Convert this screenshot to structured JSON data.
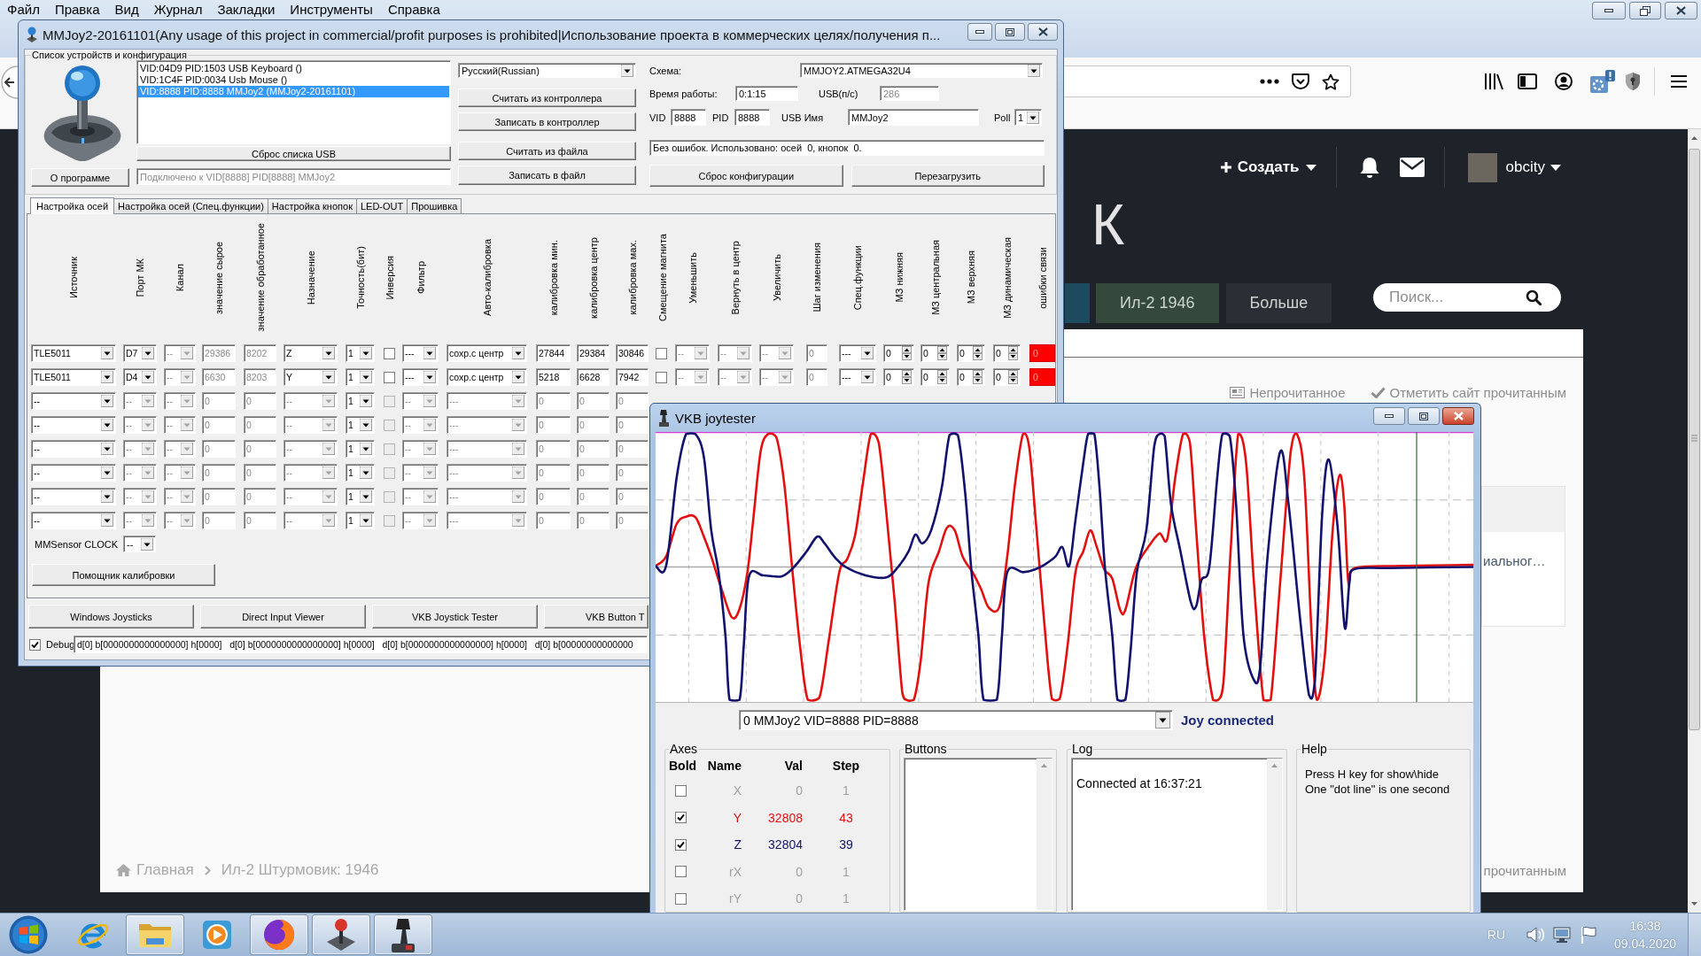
{
  "browser": {
    "menu": [
      "Файл",
      "Правка",
      "Вид",
      "Журнал",
      "Закладки",
      "Инструменты",
      "Справка"
    ],
    "site": {
      "create": "Создать",
      "user": "obcity",
      "logo": "К",
      "nav": [
        {
          "color": "#1d4a5e"
        },
        {
          "label": "Ил-2 1946",
          "color": "#34493b"
        },
        {
          "label": "Больше",
          "color": "#2a2e35"
        }
      ],
      "search": {
        "placeholder": "Поиск..."
      },
      "unread": "Непрочитанное",
      "mark_read": "Отметить сайт прочитанным",
      "card_text": "иальног…",
      "footer_link": "прочитанным",
      "breadcrumb": [
        "Главная",
        "Ил-2 Штурмовик: 1946"
      ]
    }
  },
  "mmjoy": {
    "title": "MMJoy2-20161101(Any usage of this project in commercial/profit purposes is prohibited|Использование проекта в коммерческих целях/получения п...",
    "group": "Список устройств и конфигурация",
    "devices": [
      {
        "label": "VID:04D9 PID:1503 USB Keyboard ()",
        "selected": false
      },
      {
        "label": "VID:1C4F PID:0034 Usb Mouse ()",
        "selected": false
      },
      {
        "label": "VID:8888 PID:8888 MMJoy2 (MMJoy2-20161101)",
        "selected": true
      }
    ],
    "reset_usb": "Сброс списка USB",
    "about": "О программе",
    "connection": {
      "value": "Подключено к VID[8888] PID[8888] MMJoy2",
      "disabled": true
    },
    "language": "Русский(Russian)",
    "actions": [
      "Считать из контроллера",
      "Записать в контроллер",
      "Считать из файла",
      "Записать в файл"
    ],
    "schema": {
      "label": "Схема:",
      "value": "MMJOY2.ATMEGA32U4"
    },
    "uptime": {
      "label": "Время работы:",
      "value": "0:1:15"
    },
    "usb_rate": {
      "label": "USB(п/с)",
      "value": "286",
      "disabled": true
    },
    "vid": {
      "label": "VID",
      "value": "8888"
    },
    "pid": {
      "label": "PID",
      "value": "8888"
    },
    "usb_name": {
      "label": "USB Имя",
      "value": "MMJoy2"
    },
    "poll": {
      "label": "Poll",
      "value": "1"
    },
    "status": "Без ошибок. Использовано: осей  0, кнопок  0.",
    "reset_config": "Сброс конфигурации",
    "reboot": "Перезагрузить",
    "tabs": [
      {
        "label": "Настройка осей",
        "selected": true
      },
      {
        "label": "Настройка осей (Спец.функции)",
        "selected": false
      },
      {
        "label": "Настройка кнопок",
        "selected": false
      },
      {
        "label": "LED-OUT",
        "selected": false
      },
      {
        "label": "Прошивка",
        "selected": false
      }
    ],
    "columns": [
      "Источник",
      "Порт МК",
      "Канал",
      "значение сырое",
      "значение обработанное",
      "Назначение",
      "Точность(бит)",
      "Инверсия",
      "Фильтр",
      "Авто-калибровка",
      "калибровка мин.",
      "калибровка центр",
      "калибровка мах.",
      "Смещение магнита",
      "Уменьшить",
      "Вернуть в центр",
      "Увеличить",
      "Шаг изменения",
      "Спец.функции",
      "МЗ нижняя",
      "МЗ центральная",
      "МЗ верхняя",
      "МЗ динамическая",
      "ошибки связи"
    ],
    "rows": [
      {
        "cells": [
          {
            "kind": "combo",
            "value": "TLE5011",
            "disabled": false
          },
          {
            "kind": "combo",
            "value": "D7",
            "disabled": false
          },
          {
            "kind": "combo",
            "value": "--",
            "disabled": true
          },
          {
            "kind": "field",
            "value": "29386",
            "disabled": true
          },
          {
            "kind": "field",
            "value": "8202",
            "disabled": true
          },
          {
            "kind": "combo",
            "value": "Z",
            "disabled": false
          },
          {
            "kind": "combo",
            "value": "1",
            "disabled": false
          },
          {
            "kind": "check",
            "checked": false,
            "disabled": false
          },
          {
            "kind": "combo",
            "value": "---",
            "disabled": false
          },
          {
            "kind": "combo",
            "value": "сохр.с центр",
            "disabled": false
          },
          {
            "kind": "field",
            "value": "27844",
            "disabled": false
          },
          {
            "kind": "field",
            "value": "29384",
            "disabled": false
          },
          {
            "kind": "field",
            "value": "30846",
            "disabled": false
          },
          {
            "kind": "check",
            "checked": false,
            "disabled": false
          },
          {
            "kind": "combo",
            "value": "--",
            "disabled": true
          },
          {
            "kind": "combo",
            "value": "--",
            "disabled": true
          },
          {
            "kind": "combo",
            "value": "--",
            "disabled": true
          },
          {
            "kind": "field",
            "value": "0",
            "disabled": true
          },
          {
            "kind": "combo",
            "value": "---",
            "disabled": false
          },
          {
            "kind": "spin",
            "value": "0",
            "disabled": false
          },
          {
            "kind": "spin",
            "value": "0",
            "disabled": false
          },
          {
            "kind": "spin",
            "value": "0",
            "disabled": false
          },
          {
            "kind": "spin",
            "value": "0",
            "disabled": false
          },
          {
            "kind": "error",
            "value": "0",
            "on": true,
            "disabled": false
          }
        ]
      },
      {
        "cells": [
          {
            "kind": "combo",
            "value": "TLE5011",
            "disabled": false
          },
          {
            "kind": "combo",
            "value": "D4",
            "disabled": false
          },
          {
            "kind": "combo",
            "value": "--",
            "disabled": true
          },
          {
            "kind": "field",
            "value": "6630",
            "disabled": true
          },
          {
            "kind": "field",
            "value": "8203",
            "disabled": true
          },
          {
            "kind": "combo",
            "value": "Y",
            "disabled": false
          },
          {
            "kind": "combo",
            "value": "1",
            "disabled": false
          },
          {
            "kind": "check",
            "checked": false,
            "disabled": false
          },
          {
            "kind": "combo",
            "value": "---",
            "disabled": false
          },
          {
            "kind": "combo",
            "value": "сохр.с центр",
            "disabled": false
          },
          {
            "kind": "field",
            "value": "5218",
            "disabled": false
          },
          {
            "kind": "field",
            "value": "6628",
            "disabled": false
          },
          {
            "kind": "field",
            "value": "7942",
            "disabled": false
          },
          {
            "kind": "check",
            "checked": false,
            "disabled": false
          },
          {
            "kind": "combo",
            "value": "--",
            "disabled": true
          },
          {
            "kind": "combo",
            "value": "--",
            "disabled": true
          },
          {
            "kind": "combo",
            "value": "--",
            "disabled": true
          },
          {
            "kind": "field",
            "value": "0",
            "disabled": true
          },
          {
            "kind": "combo",
            "value": "---",
            "disabled": false
          },
          {
            "kind": "spin",
            "value": "0",
            "disabled": false
          },
          {
            "kind": "spin",
            "value": "0",
            "disabled": false
          },
          {
            "kind": "spin",
            "value": "0",
            "disabled": false
          },
          {
            "kind": "spin",
            "value": "0",
            "disabled": false
          },
          {
            "kind": "error",
            "value": "0",
            "on": true,
            "disabled": false
          }
        ]
      },
      {
        "cells": [
          {
            "kind": "combo",
            "value": "--",
            "disabled": false
          },
          {
            "kind": "combo",
            "value": "--",
            "disabled": true
          },
          {
            "kind": "combo",
            "value": "--",
            "disabled": true
          },
          {
            "kind": "field",
            "value": "0",
            "disabled": true
          },
          {
            "kind": "field",
            "value": "0",
            "disabled": true
          },
          {
            "kind": "combo",
            "value": "--",
            "disabled": true
          },
          {
            "kind": "combo",
            "value": "1",
            "disabled": false
          },
          {
            "kind": "check",
            "checked": false,
            "disabled": true
          },
          {
            "kind": "combo",
            "value": "--",
            "disabled": true
          },
          {
            "kind": "combo",
            "value": "---",
            "disabled": true
          },
          {
            "kind": "field",
            "value": "0",
            "disabled": true
          },
          {
            "kind": "field",
            "value": "0",
            "disabled": true
          },
          {
            "kind": "field",
            "value": "0",
            "disabled": true
          }
        ]
      },
      {
        "cells": [
          {
            "kind": "combo",
            "value": "--",
            "disabled": false
          },
          {
            "kind": "combo",
            "value": "--",
            "disabled": true
          },
          {
            "kind": "combo",
            "value": "--",
            "disabled": true
          },
          {
            "kind": "field",
            "value": "0",
            "disabled": true
          },
          {
            "kind": "field",
            "value": "0",
            "disabled": true
          },
          {
            "kind": "combo",
            "value": "--",
            "disabled": true
          },
          {
            "kind": "combo",
            "value": "1",
            "disabled": false
          },
          {
            "kind": "check",
            "checked": false,
            "disabled": true
          },
          {
            "kind": "combo",
            "value": "--",
            "disabled": true
          },
          {
            "kind": "combo",
            "value": "---",
            "disabled": true
          },
          {
            "kind": "field",
            "value": "0",
            "disabled": true
          },
          {
            "kind": "field",
            "value": "0",
            "disabled": true
          },
          {
            "kind": "field",
            "value": "0",
            "disabled": true
          }
        ]
      },
      {
        "cells": [
          {
            "kind": "combo",
            "value": "--",
            "disabled": false
          },
          {
            "kind": "combo",
            "value": "--",
            "disabled": true
          },
          {
            "kind": "combo",
            "value": "--",
            "disabled": true
          },
          {
            "kind": "field",
            "value": "0",
            "disabled": true
          },
          {
            "kind": "field",
            "value": "0",
            "disabled": true
          },
          {
            "kind": "combo",
            "value": "--",
            "disabled": true
          },
          {
            "kind": "combo",
            "value": "1",
            "disabled": false
          },
          {
            "kind": "check",
            "checked": false,
            "disabled": true
          },
          {
            "kind": "combo",
            "value": "--",
            "disabled": true
          },
          {
            "kind": "combo",
            "value": "---",
            "disabled": true
          },
          {
            "kind": "field",
            "value": "0",
            "disabled": true
          },
          {
            "kind": "field",
            "value": "0",
            "disabled": true
          },
          {
            "kind": "field",
            "value": "0",
            "disabled": true
          }
        ]
      },
      {
        "cells": [
          {
            "kind": "combo",
            "value": "--",
            "disabled": false
          },
          {
            "kind": "combo",
            "value": "--",
            "disabled": true
          },
          {
            "kind": "combo",
            "value": "--",
            "disabled": true
          },
          {
            "kind": "field",
            "value": "0",
            "disabled": true
          },
          {
            "kind": "field",
            "value": "0",
            "disabled": true
          },
          {
            "kind": "combo",
            "value": "--",
            "disabled": true
          },
          {
            "kind": "combo",
            "value": "1",
            "disabled": false
          },
          {
            "kind": "check",
            "checked": false,
            "disabled": true
          },
          {
            "kind": "combo",
            "value": "--",
            "disabled": true
          },
          {
            "kind": "combo",
            "value": "---",
            "disabled": true
          },
          {
            "kind": "field",
            "value": "0",
            "disabled": true
          },
          {
            "kind": "field",
            "value": "0",
            "disabled": true
          },
          {
            "kind": "field",
            "value": "0",
            "disabled": true
          }
        ]
      },
      {
        "cells": [
          {
            "kind": "combo",
            "value": "--",
            "disabled": false
          },
          {
            "kind": "combo",
            "value": "--",
            "disabled": true
          },
          {
            "kind": "combo",
            "value": "--",
            "disabled": true
          },
          {
            "kind": "field",
            "value": "0",
            "disabled": true
          },
          {
            "kind": "field",
            "value": "0",
            "disabled": true
          },
          {
            "kind": "combo",
            "value": "--",
            "disabled": true
          },
          {
            "kind": "combo",
            "value": "1",
            "disabled": false
          },
          {
            "kind": "check",
            "checked": false,
            "disabled": true
          },
          {
            "kind": "combo",
            "value": "--",
            "disabled": true
          },
          {
            "kind": "combo",
            "value": "---",
            "disabled": true
          },
          {
            "kind": "field",
            "value": "0",
            "disabled": true
          },
          {
            "kind": "field",
            "value": "0",
            "disabled": true
          },
          {
            "kind": "field",
            "value": "0",
            "disabled": true
          }
        ]
      },
      {
        "cells": [
          {
            "kind": "combo",
            "value": "--",
            "disabled": false
          },
          {
            "kind": "combo",
            "value": "--",
            "disabled": true
          },
          {
            "kind": "combo",
            "value": "--",
            "disabled": true
          },
          {
            "kind": "field",
            "value": "0",
            "disabled": true
          },
          {
            "kind": "field",
            "value": "0",
            "disabled": true
          },
          {
            "kind": "combo",
            "value": "--",
            "disabled": true
          },
          {
            "kind": "combo",
            "value": "1",
            "disabled": false
          },
          {
            "kind": "check",
            "checked": false,
            "disabled": true
          },
          {
            "kind": "combo",
            "value": "--",
            "disabled": true
          },
          {
            "kind": "combo",
            "value": "---",
            "disabled": true
          },
          {
            "kind": "field",
            "value": "0",
            "disabled": true
          },
          {
            "kind": "field",
            "value": "0",
            "disabled": true
          },
          {
            "kind": "field",
            "value": "0",
            "disabled": true
          }
        ]
      }
    ],
    "clock": {
      "label": "MMSensor CLOCK",
      "value": "--"
    },
    "calibration": "Помощник калибровки",
    "tools": [
      "Windows Joysticks",
      "Direct Input Viewer",
      "VKB Joystick Tester",
      "VKB Button T"
    ],
    "debug": {
      "label": "Debug",
      "checked": true,
      "value": "d[0] b[0000000000000000] h[0000]   d[0] b[0000000000000000] h[0000]   d[0] b[0000000000000000] h[0000]   d[0] b[00000000000000"
    }
  },
  "joytester": {
    "title": "VKB joytester",
    "device": "0 MMJoy2 VID=8888 PID=8888",
    "status": "Joy connected",
    "axes_label": "Axes",
    "axes_columns": [
      "Bold",
      "Name",
      "Val",
      "Step"
    ],
    "axes": [
      {
        "name": "X",
        "checked": false,
        "value": "0",
        "step": "1"
      },
      {
        "name": "Y",
        "checked": true,
        "color": "#e31010",
        "value": "32808",
        "step": "43"
      },
      {
        "name": "Z",
        "checked": true,
        "color": "#12126e",
        "value": "32804",
        "step": "39"
      },
      {
        "name": "rX",
        "checked": false,
        "value": "0",
        "step": "1"
      },
      {
        "name": "rY",
        "checked": false,
        "value": "0",
        "step": "1"
      }
    ],
    "buttons_label": "Buttons",
    "log_label": "Log",
    "log": [
      "Connected at 16:37:21"
    ],
    "help_label": "Help",
    "help": [
      "Press H key for show\\hide",
      "One \"dot line\" is one second"
    ]
  },
  "taskbar": {
    "apps": [
      {
        "running": false
      },
      {
        "running": true
      },
      {
        "running": false
      },
      {
        "running": true
      },
      {
        "running": true
      },
      {
        "running": true
      }
    ],
    "language": "RU",
    "time": "16:38",
    "date": "09.04.2020"
  }
}
